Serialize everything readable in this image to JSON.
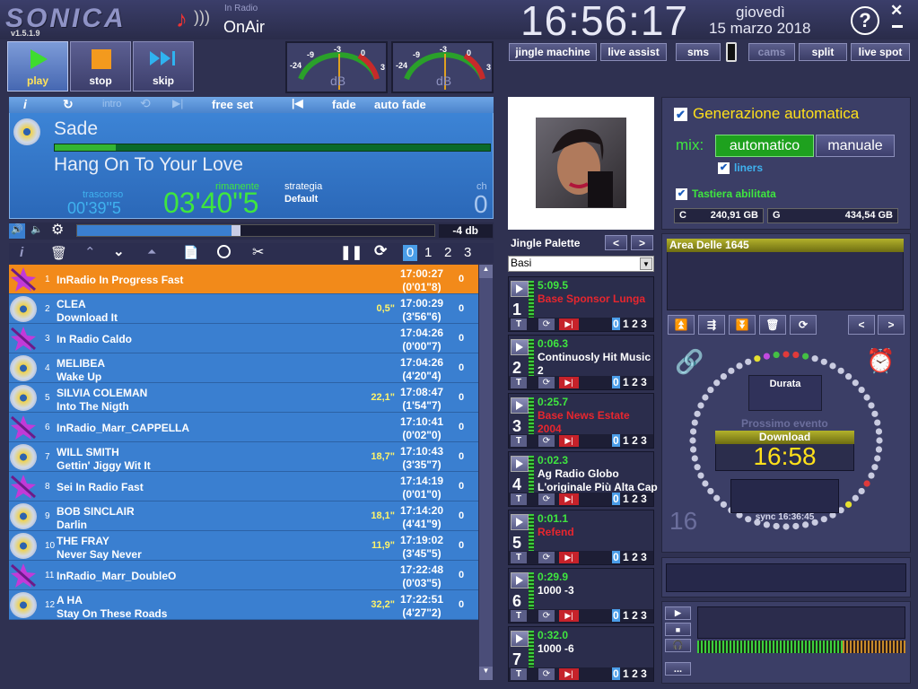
{
  "app": {
    "logo": "SONICA",
    "version": "v1.5.1.9",
    "station_label": "In Radio",
    "status": "OnAir"
  },
  "clock": {
    "time": "16:56:17",
    "day": "giovedì",
    "date": "15 marzo 2018"
  },
  "transport": {
    "play": "play",
    "stop": "stop",
    "skip": "skip"
  },
  "vu": {
    "labels": [
      "-24",
      "-9",
      "-3",
      "0",
      "3"
    ],
    "unit": "dB"
  },
  "top_buttons": {
    "jingle": "jingle machine",
    "live_assist": "live assist",
    "sms": "sms",
    "cams": "cams",
    "split": "split",
    "live_spot": "live spot"
  },
  "player": {
    "toolbar": {
      "intro": "intro",
      "free_set": "free set",
      "fade": "fade",
      "auto_fade": "auto fade"
    },
    "artist": "Sade",
    "title": "Hang On To Your Love",
    "elapsed_label": "trascorso",
    "elapsed": "00'39\"5",
    "remaining_label": "rimanente",
    "remaining": "03'40\"5",
    "strategy_label": "strategia",
    "strategy": "Default",
    "ch_label": "ch",
    "ch": "0",
    "volume_db": "-4 db",
    "progress": 0.14
  },
  "playlist_toolbar": {
    "pages": [
      "0",
      "1",
      "2",
      "3"
    ]
  },
  "playlist": [
    {
      "n": "1",
      "line1": "InRadio In Progress Fast",
      "line2": "",
      "intro": "",
      "time": "17:00:27",
      "dur": "(0'01\"8)",
      "ch": "0",
      "type": "jingle",
      "active": true
    },
    {
      "n": "2",
      "line1": "CLEA",
      "line2": "Download It",
      "intro": "0,5\"",
      "time": "17:00:29",
      "dur": "(3'56\"6)",
      "ch": "0",
      "type": "song"
    },
    {
      "n": "3",
      "line1": "In Radio Caldo",
      "line2": "",
      "intro": "",
      "time": "17:04:26",
      "dur": "(0'00\"7)",
      "ch": "0",
      "type": "jingle"
    },
    {
      "n": "4",
      "line1": "MELIBEA",
      "line2": "Wake Up",
      "intro": "",
      "time": "17:04:26",
      "dur": "(4'20\"4)",
      "ch": "0",
      "type": "song"
    },
    {
      "n": "5",
      "line1": "SILVIA COLEMAN",
      "line2": "Into The Nigth",
      "intro": "22,1\"",
      "time": "17:08:47",
      "dur": "(1'54\"7)",
      "ch": "0",
      "type": "song"
    },
    {
      "n": "6",
      "line1": "InRadio_Marr_CAPPELLA",
      "line2": "",
      "intro": "",
      "time": "17:10:41",
      "dur": "(0'02\"0)",
      "ch": "0",
      "type": "jingle"
    },
    {
      "n": "7",
      "line1": "WILL SMITH",
      "line2": "Gettin' Jiggy Wit It",
      "intro": "18,7\"",
      "time": "17:10:43",
      "dur": "(3'35\"7)",
      "ch": "0",
      "type": "song"
    },
    {
      "n": "8",
      "line1": "Sei In Radio Fast",
      "line2": "",
      "intro": "",
      "time": "17:14:19",
      "dur": "(0'01\"0)",
      "ch": "0",
      "type": "jingle"
    },
    {
      "n": "9",
      "line1": "BOB SINCLAIR",
      "line2": "Darlin",
      "intro": "18,1\"",
      "time": "17:14:20",
      "dur": "(4'41\"9)",
      "ch": "0",
      "type": "song"
    },
    {
      "n": "10",
      "line1": "THE FRAY",
      "line2": "Never Say Never",
      "intro": "11,9\"",
      "time": "17:19:02",
      "dur": "(3'45\"5)",
      "ch": "0",
      "type": "song"
    },
    {
      "n": "11",
      "line1": "InRadio_Marr_DoubleO",
      "line2": "",
      "intro": "",
      "time": "17:22:48",
      "dur": "(0'03\"5)",
      "ch": "0",
      "type": "jingle"
    },
    {
      "n": "12",
      "line1": "A HA",
      "line2": "Stay On These Roads",
      "intro": "32,2\"",
      "time": "17:22:51",
      "dur": "(4'27\"2)",
      "ch": "0",
      "type": "song"
    }
  ],
  "jingle_palette": {
    "label": "Jingle Palette",
    "category": "Basi",
    "items": [
      {
        "n": "1",
        "dur": "5:09.5",
        "l1": "Base Sponsor Lunga",
        "l2": "",
        "red": true
      },
      {
        "n": "2",
        "dur": "0:06.3",
        "l1": "Continuosly Hit Music",
        "l2": "2",
        "red": false
      },
      {
        "n": "3",
        "dur": "0:25.7",
        "l1": "Base News Estate",
        "l2": "2004",
        "red": true
      },
      {
        "n": "4",
        "dur": "0:02.3",
        "l1": "Ag Radio Globo",
        "l2": "L'originale Più Alta Cap",
        "red": false
      },
      {
        "n": "5",
        "dur": "0:01.1",
        "l1": "Refend",
        "l2": "",
        "red": true
      },
      {
        "n": "6",
        "dur": "0:29.9",
        "l1": "1000 -3",
        "l2": "",
        "red": false
      },
      {
        "n": "7",
        "dur": "0:32.0",
        "l1": "1000 -6",
        "l2": "",
        "red": false
      }
    ],
    "page_nums": [
      "0",
      "1",
      "2",
      "3"
    ]
  },
  "automation": {
    "title": "Generazione automatica",
    "mix_label": "mix:",
    "auto": "automatico",
    "manual": "manuale",
    "liners": "liners",
    "keyboard": "Tastiera abilitata",
    "disk_c_label": "C",
    "disk_c": "240,91 GB",
    "disk_g_label": "G",
    "disk_g": "434,54 GB"
  },
  "area": {
    "title": "Area Delle 1645"
  },
  "clockpanel": {
    "duration": "Durata",
    "next_label": "Prossimo evento",
    "next_name": "Download",
    "next_time": "16:58",
    "sync": "sync 16:36:45",
    "big_num": "16"
  },
  "bottom": {
    "more": "..."
  },
  "colors": {
    "accent_orange": "#f28a1a",
    "row_blue": "#3a7fd0",
    "green_text": "#3fe63f",
    "yellow": "#ffe01a"
  }
}
